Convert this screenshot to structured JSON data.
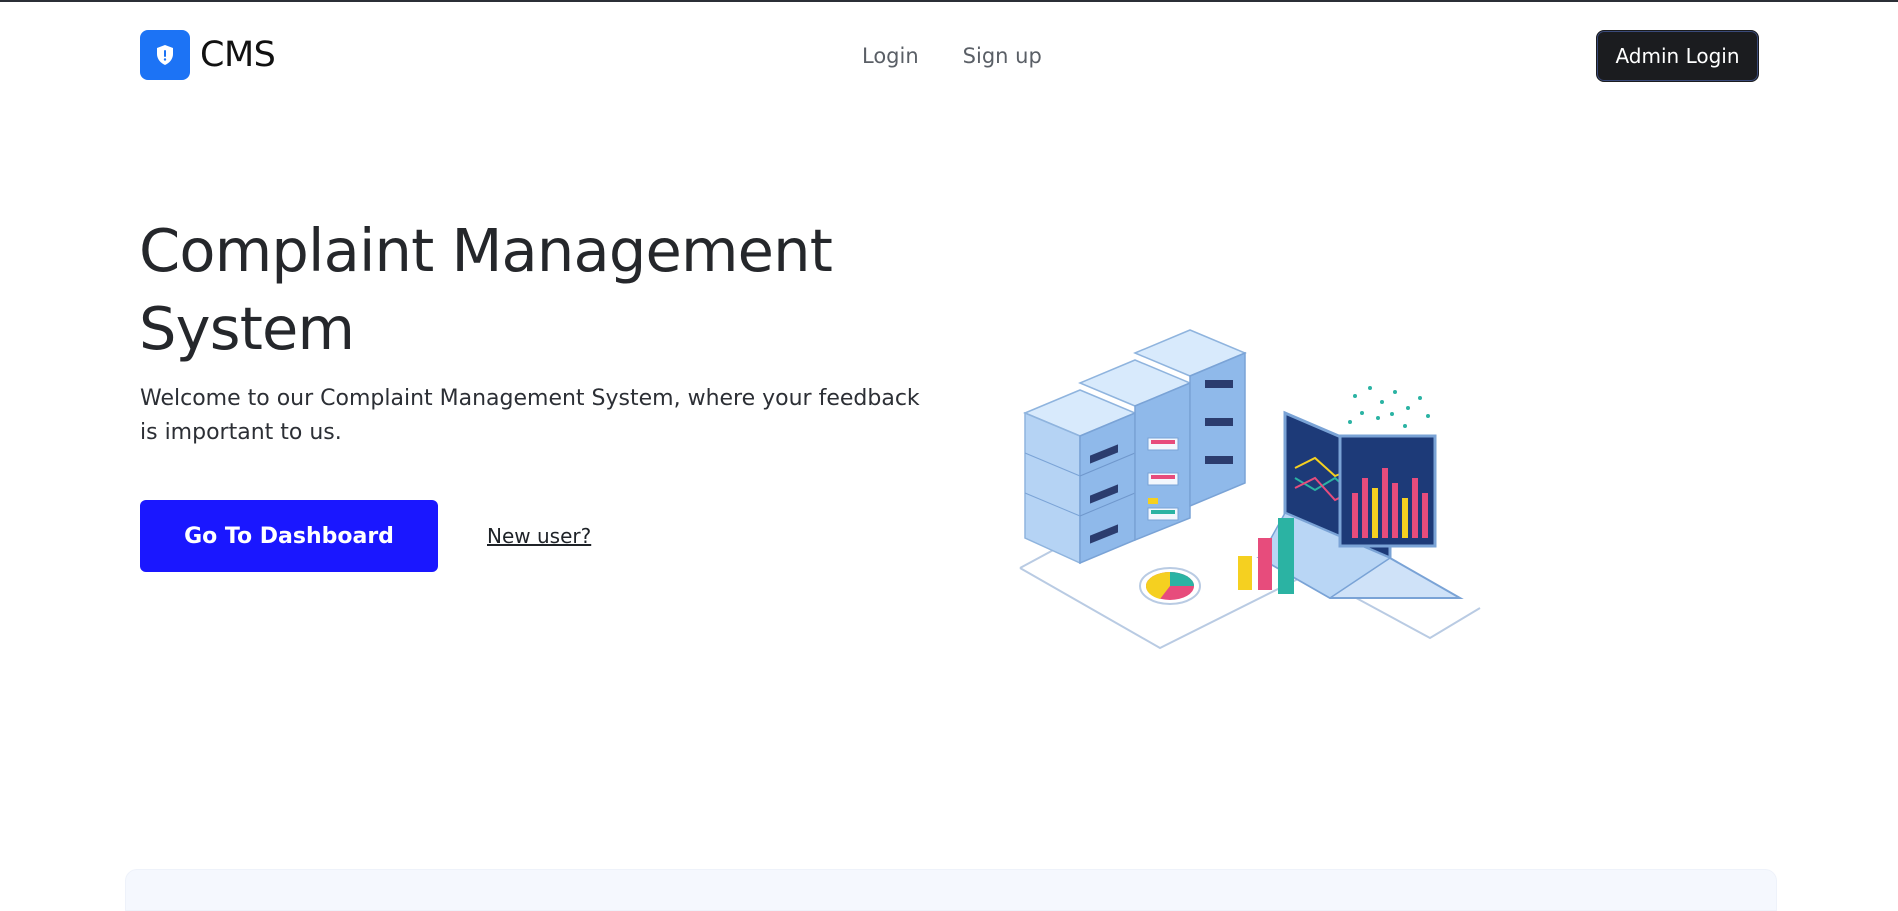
{
  "header": {
    "brand": "CMS",
    "logo_icon": "shield-icon",
    "nav": [
      {
        "label": "Login"
      },
      {
        "label": "Sign up"
      }
    ],
    "admin_button": "Admin Login"
  },
  "hero": {
    "title": "Complaint Management System",
    "description": "Welcome to our Complaint Management System, where your feedback is important to us.",
    "cta_button": "Go To Dashboard",
    "secondary_link": "New user?",
    "illustration": "servers-laptop-analytics-illustration"
  },
  "colors": {
    "accent_blue": "#1a17ff",
    "logo_blue": "#1c73f5",
    "admin_button_bg": "#1b1c1f"
  }
}
